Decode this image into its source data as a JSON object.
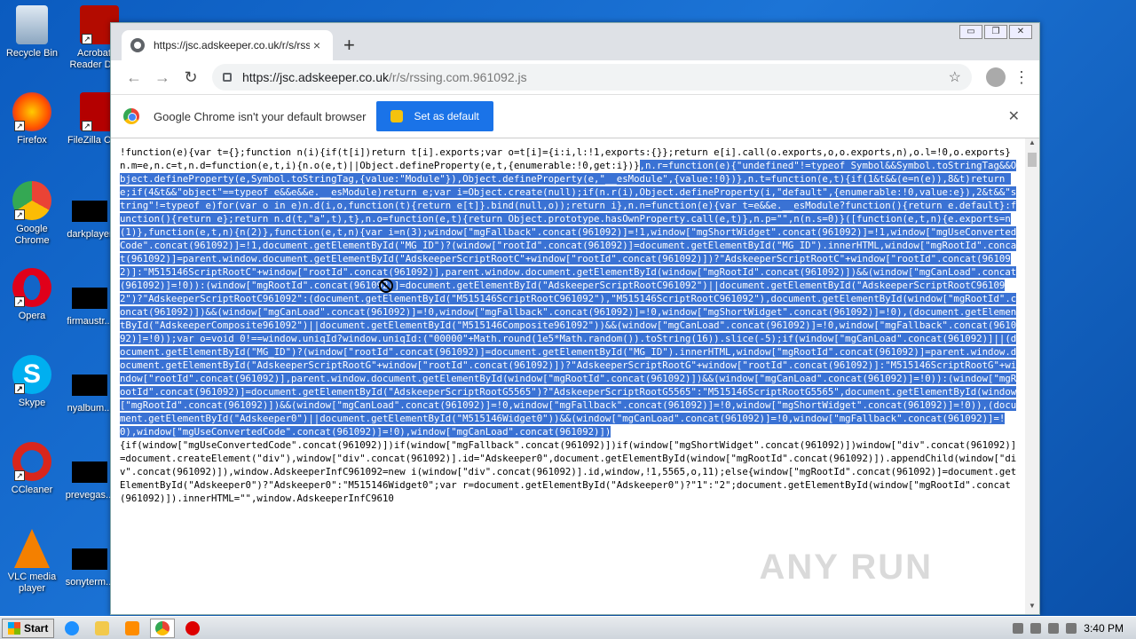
{
  "desktop": {
    "icons": [
      {
        "label": "Recycle Bin"
      },
      {
        "label": "Acrobat Reader DC"
      },
      {
        "label": "Firefox"
      },
      {
        "label": "FileZilla Client"
      },
      {
        "label": "Google Chrome"
      },
      {
        "label": "darkplayer"
      },
      {
        "label": "Opera"
      },
      {
        "label": "firmaustr..."
      },
      {
        "label": "Skype"
      },
      {
        "label": "nyalbum..."
      },
      {
        "label": "CCleaner"
      },
      {
        "label": "prevegas..."
      },
      {
        "label": "VLC media player"
      },
      {
        "label": "sonyterm..."
      }
    ]
  },
  "browser": {
    "tab_title": "https://jsc.adskeeper.co.uk/r/s/rssi",
    "tab_close": "×",
    "new_tab": "+",
    "url_host": "https://jsc.adskeeper.co.uk",
    "url_path": "/r/s/rssing.com.961092.js",
    "infobar_text": "Google Chrome isn't your default browser",
    "infobar_button": "Set as default",
    "infobar_close": "✕",
    "nav": {
      "back": "←",
      "forward": "→",
      "reload": "↻",
      "star": "☆",
      "menu": "⋮"
    },
    "window_controls": {
      "min": "▭",
      "restore": "❐",
      "close": "✕"
    }
  },
  "code": {
    "pre": "!function(e){var t={};function n(i){if(t[i])return t[i].exports;var o=t[i]={i:i,l:!1,exports:{}};return e[i].call(o.exports,o,o.exports,n),o.l=!0,o.exports}n.m=e,n.c=t,n.d=function(e,t,i){n.o(e,t)||Object.defineProperty(e,t,{enumerable:!0,get:i})}",
    "selected": ",n.r=function(e){\"undefined\"!=typeof Symbol&&Symbol.toStringTag&&Object.defineProperty(e,Symbol.toStringTag,{value:\"Module\"}),Object.defineProperty(e,\"__esModule\",{value:!0})},n.t=function(e,t){if(1&t&&(e=n(e)),8&t)return e;if(4&t&&\"object\"==typeof e&&e&&e.__esModule)return e;var i=Object.create(null);if(n.r(i),Object.defineProperty(i,\"default\",{enumerable:!0,value:e}),2&t&&\"string\"!=typeof e)for(var o in e)n.d(i,o,function(t){return e[t]}.bind(null,o));return i},n.n=function(e){var t=e&&e.__esModule?function(){return e.default}:function(){return e};return n.d(t,\"a\",t),t},n.o=function(e,t){return Object.prototype.hasOwnProperty.call(e,t)},n.p=\"\",n(n.s=0)}([function(e,t,n){e.exports=n(1)},function(e,t,n){n(2)},function(e,t,n){var i=n(3);window[\"mgFallback\".concat(961092)]=!1,window[\"mgShortWidget\".concat(961092)]=!1,window[\"mgUseConvertedCode\".concat(961092)]=!1,document.getElementById(\"MG_ID\")?(window[\"rootId\".concat(961092)]=document.getElementById(\"MG_ID\").innerHTML,window[\"mgRootId\".concat(961092)]=parent.window.document.getElementById(\"AdskeeperScriptRootC\"+window[\"rootId\".concat(961092)])?\"AdskeeperScriptRootC\"+window[\"rootId\".concat(961092)]:\"M515146ScriptRootC\"+window[\"rootId\".concat(961092)],parent.window.document.getElementById(window[\"mgRootId\".concat(961092)])&&(window[\"mgCanLoad\".concat(961092)]=!0)):(window[\"mgRootId\".concat(961092)]=document.getElementById(\"AdskeeperScriptRootC961092\")||document.getElementById(\"AdskeeperScriptRootC961092\")?\"AdskeeperScriptRootC961092\":(document.getElementById(\"M515146ScriptRootC961092\"),\"M515146ScriptRootC961092\"),document.getElementById(window[\"mgRootId\".concat(961092)])&&(window[\"mgCanLoad\".concat(961092)]=!0,window[\"mgFallback\".concat(961092)]=!0,window[\"mgShortWidget\".concat(961092)]=!0),(document.getElementById(\"AdskeeperComposite961092\")||document.getElementById(\"M515146Composite961092\"))&&(window[\"mgCanLoad\".concat(961092)]=!0,window[\"mgFallback\".concat(961092)]=!0));var o=void 0!==window.uniqId?window.uniqId:(\"00000\"+Math.round(1e5*Math.random()).toString(16)).slice(-5);if(window[\"mgCanLoad\".concat(961092)]||(document.getElementById(\"MG_ID\")?(window[\"rootId\".concat(961092)]=document.getElementById(\"MG_ID\").innerHTML,window[\"mgRootId\".concat(961092)]=parent.window.document.getElementById(\"AdskeeperScriptRootG\"+window[\"rootId\".concat(961092)])?\"AdskeeperScriptRootG\"+window[\"rootId\".concat(961092)]:\"M515146ScriptRootG\"+window[\"rootId\".concat(961092)],parent.window.document.getElementById(window[\"mgRootId\".concat(961092)])&&(window[\"mgCanLoad\".concat(961092)]=!0)):(window[\"mgRootId\".concat(961092)]=document.getElementById(\"AdskeeperScriptRootG5565\")?\"AdskeeperScriptRootG5565\":\"M515146ScriptRootG5565\",document.getElementById(window[\"mgRootId\".concat(961092)])&&(window[\"mgCanLoad\".concat(961092)]=!0,window[\"mgFallback\".concat(961092)]=!0,window[\"mgShortWidget\".concat(961092)]=!0)),(document.getElementById(\"Adskeeper0\")||document.getElementById(\"M515146Widget0\"))&&(window[\"mgCanLoad\".concat(961092)]=!0,window[\"mgFallback\".concat(961092)]=!0),window[\"mgUseConvertedCode\".concat(961092)]=!0),window[\"mgCanLoad\".concat(961092)])",
    "post": "{if(window[\"mgUseConvertedCode\".concat(961092)])if(window[\"mgFallback\".concat(961092)])if(window[\"mgShortWidget\".concat(961092)])window[\"div\".concat(961092)]=document.createElement(\"div\"),window[\"div\".concat(961092)].id=\"Adskeeper0\",document.getElementById(window[\"mgRootId\".concat(961092)]).appendChild(window[\"div\".concat(961092)]),window.AdskeeperInfC961092=new i(window[\"div\".concat(961092)].id,window,!1,5565,o,11);else{window[\"mgRootId\".concat(961092)]=document.getElementById(\"Adskeeper0\")?\"Adskeeper0\":\"M515146Widget0\";var r=document.getElementById(\"Adskeeper0\")?\"1\":\"2\";document.getElementById(window[\"mgRootId\".concat(961092)]).innerHTML=\"\",window.AdskeeperInfC9610"
  },
  "watermark": "ANY RUN",
  "taskbar": {
    "start_label": "Start",
    "clock": "3:40 PM"
  }
}
